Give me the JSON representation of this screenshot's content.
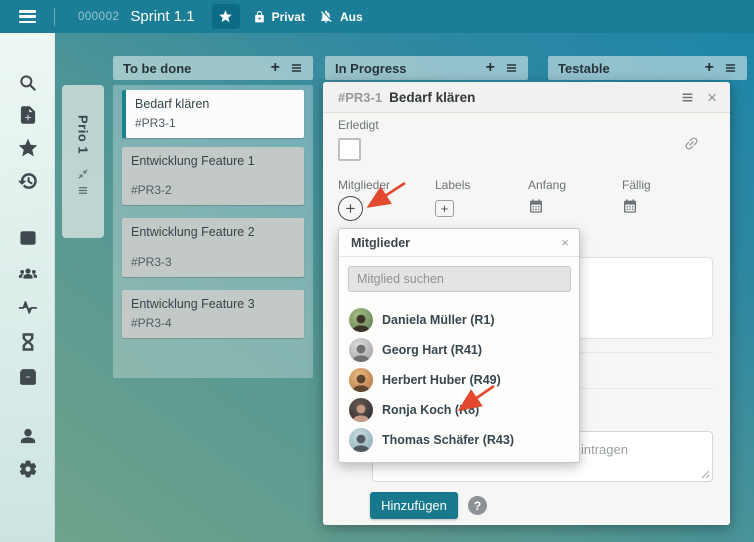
{
  "topbar": {
    "board_number": "000002",
    "board_title": "Sprint 1.1",
    "privacy_label": "Privat",
    "notifications_label": "Aus"
  },
  "sidebar": {
    "icons": [
      "search",
      "note-add",
      "star",
      "history",
      "board-columns",
      "team",
      "activity",
      "hourglass",
      "archive",
      "user",
      "settings"
    ]
  },
  "board": {
    "swimlane_title": "Prio 1",
    "columns": [
      {
        "title": "To be done",
        "cards": [
          {
            "title": "Bedarf klären",
            "id": "#PR3-1"
          },
          {
            "title": "Entwicklung Feature 1",
            "id": "#PR3-2"
          },
          {
            "title": "Entwicklung Feature 2",
            "id": "#PR3-3"
          },
          {
            "title": "Entwicklung Feature 3",
            "id": "#PR3-4"
          }
        ]
      },
      {
        "title": "In Progress",
        "cards": []
      },
      {
        "title": "Testable",
        "cards": []
      }
    ]
  },
  "card_detail": {
    "id": "#PR3-1",
    "title": "Bedarf klären",
    "done_label": "Erledigt",
    "field_labels": {
      "members": "Mitglieder",
      "labels": "Labels",
      "start": "Anfang",
      "due": "Fällig"
    },
    "comment_placeholder_visible": "intragen",
    "submit_label": "Hinzufügen"
  },
  "members_popup": {
    "title": "Mitglieder",
    "search_placeholder": "Mitglied suchen",
    "members": [
      {
        "name": "Daniela Müller (R1)",
        "avatar_style": "background:radial-gradient(circle at 38% 30%,#A4BC82,#5D7A52);color:#3C3328"
      },
      {
        "name": "Georg Hart (R41)",
        "avatar_style": "background:radial-gradient(circle at 40% 30%,#DCDCDA,#9A9A98);color:#70706E"
      },
      {
        "name": "Herbert Huber (R49)",
        "avatar_style": "background:radial-gradient(circle at 40% 30%,#E9BA80,#B06F3E);color:#5D4430"
      },
      {
        "name": "Ronja Koch (R8)",
        "avatar_style": "background:radial-gradient(circle at 40% 30%,#6B5A52,#23262E);color:#C59A86"
      },
      {
        "name": "Thomas Schäfer (R43)",
        "avatar_style": "background:radial-gradient(circle at 40% 30%,#C6DAE0,#88A7B2);color:#4E5A60"
      }
    ]
  },
  "glyphs": {
    "plus": "+",
    "close": "×",
    "help": "?"
  },
  "colors": {
    "topbar": "#1B7E96",
    "accent_teal": "#19798C",
    "board_gradient_start": "#6FA28B",
    "board_gradient_end": "#1E85A7",
    "active_card_border": "#1D808F",
    "arrow_red": "#E2492F"
  }
}
